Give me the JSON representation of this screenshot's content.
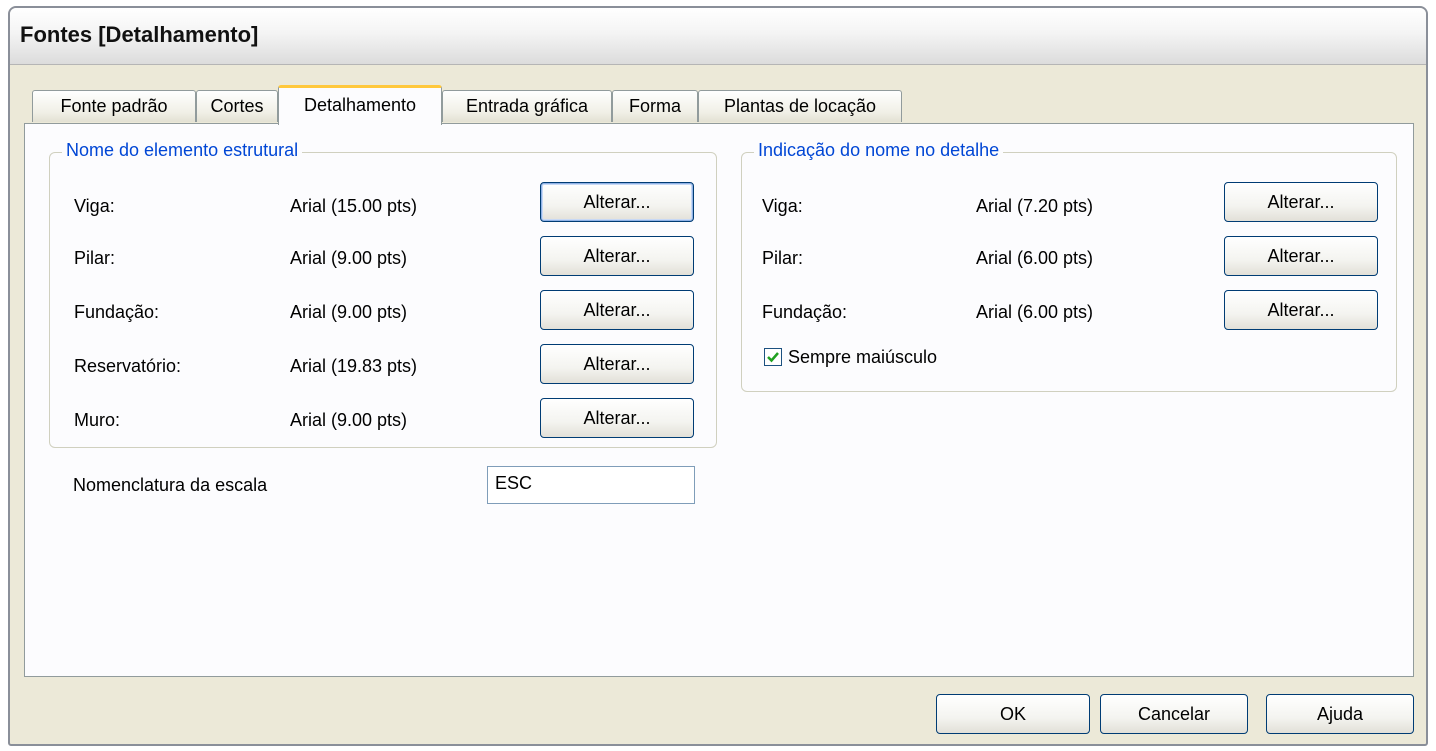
{
  "window": {
    "title": "Fontes [Detalhamento]"
  },
  "tabs": [
    {
      "label": "Fonte padrão",
      "active": false
    },
    {
      "label": "Cortes",
      "active": false
    },
    {
      "label": "Detalhamento",
      "active": true
    },
    {
      "label": "Entrada gráfica",
      "active": false
    },
    {
      "label": "Forma",
      "active": false
    },
    {
      "label": "Plantas de locação",
      "active": false
    }
  ],
  "left_group": {
    "title": "Nome do elemento estrutural",
    "rows": [
      {
        "label": "Viga:",
        "value": "Arial (15.00 pts)",
        "button": "Alterar..."
      },
      {
        "label": "Pilar:",
        "value": "Arial (9.00 pts)",
        "button": "Alterar..."
      },
      {
        "label": "Fundação:",
        "value": "Arial (9.00 pts)",
        "button": "Alterar..."
      },
      {
        "label": "Reservatório:",
        "value": "Arial (19.83 pts)",
        "button": "Alterar..."
      },
      {
        "label": "Muro:",
        "value": "Arial (9.00 pts)",
        "button": "Alterar..."
      }
    ]
  },
  "right_group": {
    "title": "Indicação do nome no detalhe",
    "rows": [
      {
        "label": "Viga:",
        "value": "Arial (7.20 pts)",
        "button": "Alterar..."
      },
      {
        "label": "Pilar:",
        "value": "Arial (6.00 pts)",
        "button": "Alterar..."
      },
      {
        "label": "Fundação:",
        "value": "Arial (6.00 pts)",
        "button": "Alterar..."
      }
    ],
    "checkbox": {
      "label": "Sempre maiúsculo",
      "checked": true
    }
  },
  "scale": {
    "label": "Nomenclatura da escala",
    "value": "ESC"
  },
  "footer": {
    "ok": "OK",
    "cancel": "Cancelar",
    "help": "Ajuda"
  },
  "colors": {
    "group_title": "#0046d5",
    "active_tab_accent": "#ffc83c",
    "dialog_bg": "#ece9d8"
  }
}
